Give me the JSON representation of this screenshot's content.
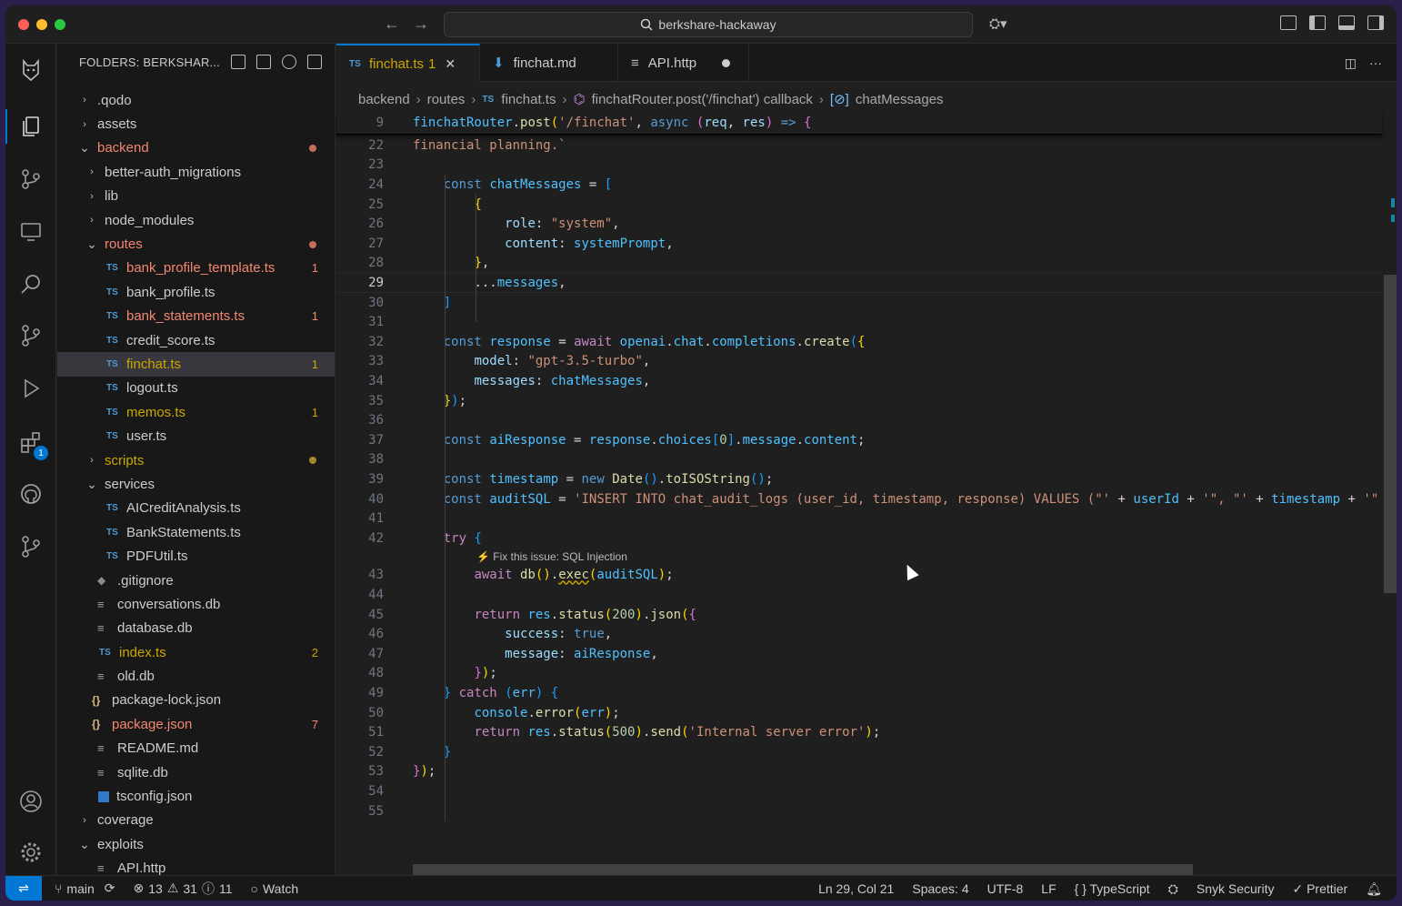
{
  "titlebar": {
    "search_text": "berkshare-hackaway"
  },
  "sidebar": {
    "title": "FOLDERS: BERKSHAR...",
    "items": [
      {
        "label": ".qodo",
        "kind": "folder",
        "open": false,
        "depth": 0
      },
      {
        "label": "assets",
        "kind": "folder",
        "open": false,
        "depth": 0
      },
      {
        "label": "backend",
        "kind": "folder",
        "open": true,
        "depth": 0,
        "color": "#f48771",
        "dot": "#c56d5b"
      },
      {
        "label": "better-auth_migrations",
        "kind": "folder",
        "open": false,
        "depth": 1
      },
      {
        "label": "lib",
        "kind": "folder",
        "open": false,
        "depth": 1
      },
      {
        "label": "node_modules",
        "kind": "folder",
        "open": false,
        "depth": 1
      },
      {
        "label": "routes",
        "kind": "folder",
        "open": true,
        "depth": 1,
        "color": "#f48771",
        "dot": "#c56d5b"
      },
      {
        "label": "bank_profile_template.ts",
        "kind": "ts",
        "depth": 2,
        "color": "#f48771",
        "count": "1"
      },
      {
        "label": "bank_profile.ts",
        "kind": "ts",
        "depth": 2
      },
      {
        "label": "bank_statements.ts",
        "kind": "ts",
        "depth": 2,
        "color": "#f48771",
        "count": "1"
      },
      {
        "label": "credit_score.ts",
        "kind": "ts",
        "depth": 2
      },
      {
        "label": "finchat.ts",
        "kind": "ts",
        "depth": 2,
        "color": "#cca700",
        "count": "1",
        "selected": true
      },
      {
        "label": "logout.ts",
        "kind": "ts",
        "depth": 2
      },
      {
        "label": "memos.ts",
        "kind": "ts",
        "depth": 2,
        "color": "#cca700",
        "count": "1"
      },
      {
        "label": "user.ts",
        "kind": "ts",
        "depth": 2
      },
      {
        "label": "scripts",
        "kind": "folder",
        "open": false,
        "depth": 1,
        "color": "#cca700",
        "dot": "#a08a2a"
      },
      {
        "label": "services",
        "kind": "folder",
        "open": true,
        "depth": 1
      },
      {
        "label": "AICreditAnalysis.ts",
        "kind": "ts",
        "depth": 2
      },
      {
        "label": "BankStatements.ts",
        "kind": "ts",
        "depth": 2
      },
      {
        "label": "PDFUtil.ts",
        "kind": "ts",
        "depth": 2
      },
      {
        "label": ".gitignore",
        "kind": "diamond",
        "depth": 1
      },
      {
        "label": "conversations.db",
        "kind": "lines",
        "depth": 1
      },
      {
        "label": "database.db",
        "kind": "lines",
        "depth": 1
      },
      {
        "label": "index.ts",
        "kind": "ts",
        "depth": 1,
        "color": "#cca700",
        "count": "2"
      },
      {
        "label": "old.db",
        "kind": "lines",
        "depth": 1
      },
      {
        "label": "package-lock.json",
        "kind": "json",
        "depth": 1
      },
      {
        "label": "package.json",
        "kind": "json",
        "depth": 1,
        "color": "#f48771",
        "count": "7"
      },
      {
        "label": "README.md",
        "kind": "lines",
        "depth": 1
      },
      {
        "label": "sqlite.db",
        "kind": "lines",
        "depth": 1
      },
      {
        "label": "tsconfig.json",
        "kind": "tsconfig",
        "depth": 1
      },
      {
        "label": "coverage",
        "kind": "folder",
        "open": false,
        "depth": 0
      },
      {
        "label": "exploits",
        "kind": "folder",
        "open": true,
        "depth": 0
      },
      {
        "label": "API.http",
        "kind": "lines",
        "depth": 1
      }
    ]
  },
  "activity": {
    "extensions_badge": "1"
  },
  "tabs": [
    {
      "label": "finchat.ts",
      "count": "1",
      "icon": "TS",
      "active": true
    },
    {
      "label": "finchat.md",
      "icon": "md-icon"
    },
    {
      "label": "API.http",
      "icon": "http-icon",
      "dirty": true
    }
  ],
  "breadcrumb": [
    "backend",
    "routes",
    "finchat.ts",
    "finchatRouter.post('/finchat') callback",
    "chatMessages"
  ],
  "editor": {
    "sticky": {
      "num": "9",
      "html": "<span class='v'>finchatRouter</span><span class='w'>.</span><span class='f'>post</span><span class='br1'>(</span><span class='s'>'/finchat'</span><span class='w'>, </span><span class='k'>async</span><span class='w'> </span><span class='br2'>(</span><span class='p'>req</span><span class='w'>, </span><span class='p'>res</span><span class='br2'>)</span><span class='w'> </span><span class='k'>=&gt;</span><span class='w'> </span><span class='br2'>{</span>"
    },
    "hint": "⚡ Fix this issue: SQL Injection",
    "lines": [
      {
        "num": "22",
        "html": "<span class='s'>financial planning.`</span>"
      },
      {
        "num": "23",
        "html": ""
      },
      {
        "num": "24",
        "html": "    <span class='k'>const</span> <span class='v'>chatMessages</span> <span class='w'>=</span> <span class='br3'>[</span>"
      },
      {
        "num": "25",
        "html": "        <span class='br1'>{</span>"
      },
      {
        "num": "26",
        "html": "            <span class='p'>role</span><span class='w'>: </span><span class='s'>\"system\"</span><span class='w'>,</span>"
      },
      {
        "num": "27",
        "html": "            <span class='p'>content</span><span class='w'>: </span><span class='v'>systemPrompt</span><span class='w'>,</span>"
      },
      {
        "num": "28",
        "html": "        <span class='br1'>}</span><span class='w'>,</span>"
      },
      {
        "num": "29",
        "html": "        <span class='w'>...</span><span class='v'>messages</span><span class='w'>,</span>",
        "current": true
      },
      {
        "num": "30",
        "html": "    <span class='br3'>]</span>"
      },
      {
        "num": "31",
        "html": ""
      },
      {
        "num": "32",
        "html": "    <span class='k'>const</span> <span class='v'>response</span> <span class='w'>=</span> <span class='kc'>await</span> <span class='v'>openai</span><span class='w'>.</span><span class='v'>chat</span><span class='w'>.</span><span class='v'>completions</span><span class='w'>.</span><span class='f'>create</span><span class='br3'>(</span><span class='br1'>{</span>"
      },
      {
        "num": "33",
        "html": "        <span class='p'>model</span><span class='w'>: </span><span class='s'>\"gpt-3.5-turbo\"</span><span class='w'>,</span>"
      },
      {
        "num": "34",
        "html": "        <span class='p'>messages</span><span class='w'>: </span><span class='v'>chatMessages</span><span class='w'>,</span>"
      },
      {
        "num": "35",
        "html": "    <span class='br1'>}</span><span class='br3'>)</span><span class='w'>;</span>"
      },
      {
        "num": "36",
        "html": ""
      },
      {
        "num": "37",
        "html": "    <span class='k'>const</span> <span class='v'>aiResponse</span> <span class='w'>=</span> <span class='v'>response</span><span class='w'>.</span><span class='v'>choices</span><span class='br3'>[</span><span class='n'>0</span><span class='br3'>]</span><span class='w'>.</span><span class='v'>message</span><span class='w'>.</span><span class='v'>content</span><span class='w'>;</span>"
      },
      {
        "num": "38",
        "html": ""
      },
      {
        "num": "39",
        "html": "    <span class='k'>const</span> <span class='v'>timestamp</span> <span class='w'>=</span> <span class='k'>new</span> <span class='f'>Date</span><span class='br3'>()</span><span class='w'>.</span><span class='f'>toISOString</span><span class='br3'>()</span><span class='w'>;</span>"
      },
      {
        "num": "40",
        "html": "    <span class='k'>const</span> <span class='v'>auditSQL</span> <span class='w'>=</span> <span class='s'>'INSERT INTO chat_audit_logs (user_id, timestamp, response) VALUES (\"'</span> <span class='w'>+</span> <span class='v'>userId</span> <span class='w'>+</span> <span class='s'>'\", \"'</span> <span class='w'>+</span> <span class='v'>timestamp</span> <span class='w'>+</span> <span class='s'>'\"</span>"
      },
      {
        "num": "41",
        "html": ""
      },
      {
        "num": "42",
        "html": "    <span class='kc'>try</span> <span class='br3'>{</span>",
        "after_hint": true
      },
      {
        "num": "43",
        "html": "        <span class='kc'>await</span> <span class='f'>db</span><span class='br1'>()</span><span class='w'>.</span><span class='f squig'>exec</span><span class='br1'>(</span><span class='v'>auditSQL</span><span class='br1'>)</span><span class='w'>;</span>"
      },
      {
        "num": "44",
        "html": ""
      },
      {
        "num": "45",
        "html": "        <span class='kc'>return</span> <span class='v'>res</span><span class='w'>.</span><span class='f'>status</span><span class='br1'>(</span><span class='n'>200</span><span class='br1'>)</span><span class='w'>.</span><span class='f'>json</span><span class='br1'>(</span><span class='br2'>{</span>"
      },
      {
        "num": "46",
        "html": "            <span class='p'>success</span><span class='w'>: </span><span class='k'>true</span><span class='w'>,</span>"
      },
      {
        "num": "47",
        "html": "            <span class='p'>message</span><span class='w'>: </span><span class='v'>aiResponse</span><span class='w'>,</span>"
      },
      {
        "num": "48",
        "html": "        <span class='br2'>}</span><span class='br1'>)</span><span class='w'>;</span>"
      },
      {
        "num": "49",
        "html": "    <span class='br3'>}</span> <span class='kc'>catch</span> <span class='br3'>(</span><span class='v'>err</span><span class='br3'>)</span> <span class='br3'>{</span>"
      },
      {
        "num": "50",
        "html": "        <span class='v'>console</span><span class='w'>.</span><span class='f'>error</span><span class='br1'>(</span><span class='v'>err</span><span class='br1'>)</span><span class='w'>;</span>"
      },
      {
        "num": "51",
        "html": "        <span class='kc'>return</span> <span class='v'>res</span><span class='w'>.</span><span class='f'>status</span><span class='br1'>(</span><span class='n'>500</span><span class='br1'>)</span><span class='w'>.</span><span class='f'>send</span><span class='br1'>(</span><span class='s'>'Internal server error'</span><span class='br1'>)</span><span class='w'>;</span>"
      },
      {
        "num": "52",
        "html": "    <span class='br3'>}</span>"
      },
      {
        "num": "53",
        "html": "<span class='br2'>}</span><span class='br1'>)</span><span class='w'>;</span>"
      },
      {
        "num": "54",
        "html": ""
      },
      {
        "num": "55",
        "html": ""
      }
    ]
  },
  "statusbar": {
    "branch": "main",
    "errors": "13",
    "warnings": "31",
    "infos": "11",
    "watch": "Watch",
    "position": "Ln 29, Col 21",
    "spaces": "Spaces: 4",
    "encoding": "UTF-8",
    "eol": "LF",
    "language": "TypeScript",
    "snyk": "Snyk Security",
    "prettier": "Prettier"
  }
}
